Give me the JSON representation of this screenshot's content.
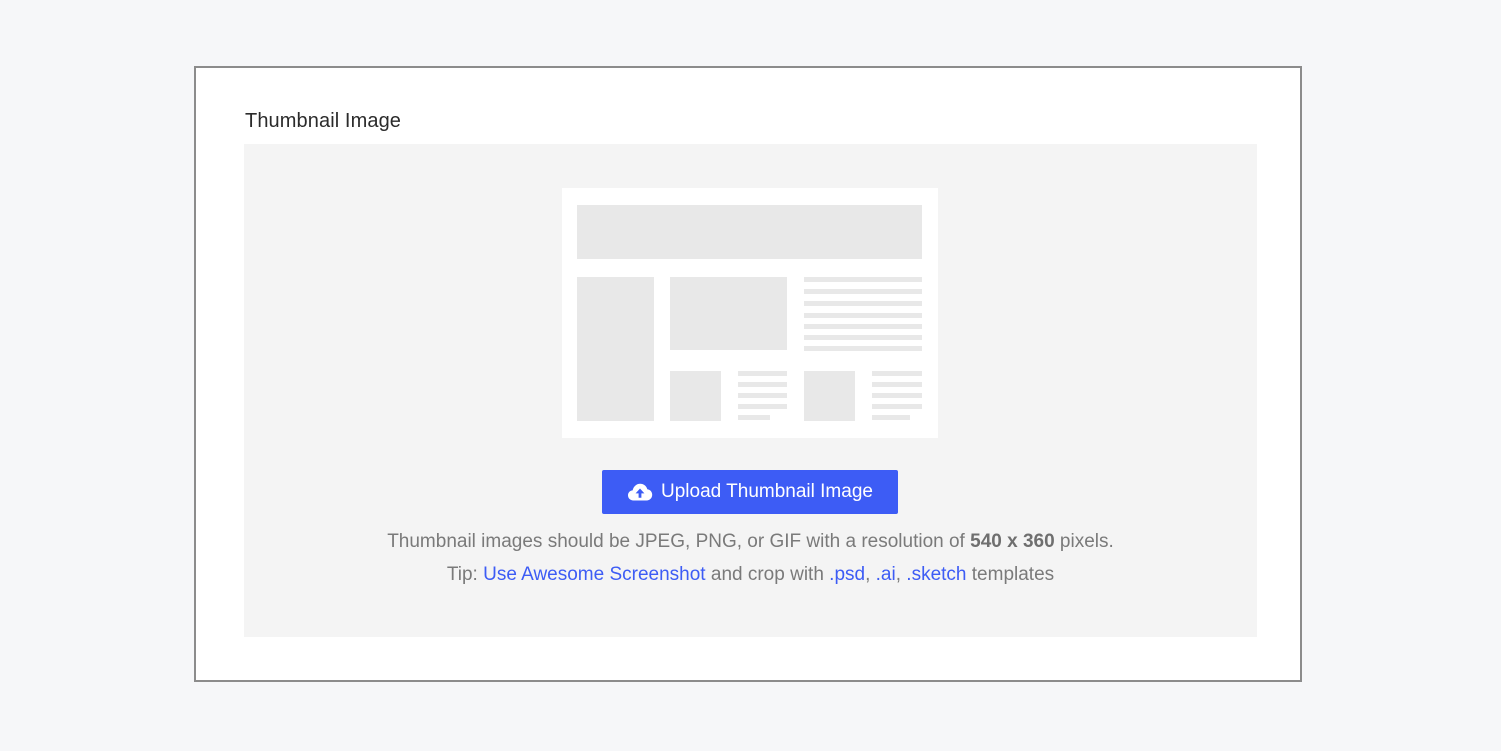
{
  "section": {
    "label": "Thumbnail Image"
  },
  "upload": {
    "button_label": "Upload Thumbnail Image",
    "icon": "cloud-upload-icon"
  },
  "requirements": {
    "prefix": "Thumbnail images should be JPEG, PNG, or GIF with a resolution of ",
    "resolution": "540 x 360",
    "suffix": " pixels."
  },
  "tip": {
    "prefix": "Tip: ",
    "link_text": "Use Awesome Screenshot",
    "middle": " and crop with ",
    "templates": [
      ".psd",
      ".ai",
      ".sketch"
    ],
    "separator": ", ",
    "suffix": " templates"
  },
  "colors": {
    "accent": "#3d5cf5",
    "dropzone_bg": "#f4f4f4",
    "placeholder": "#e8e8e8"
  }
}
